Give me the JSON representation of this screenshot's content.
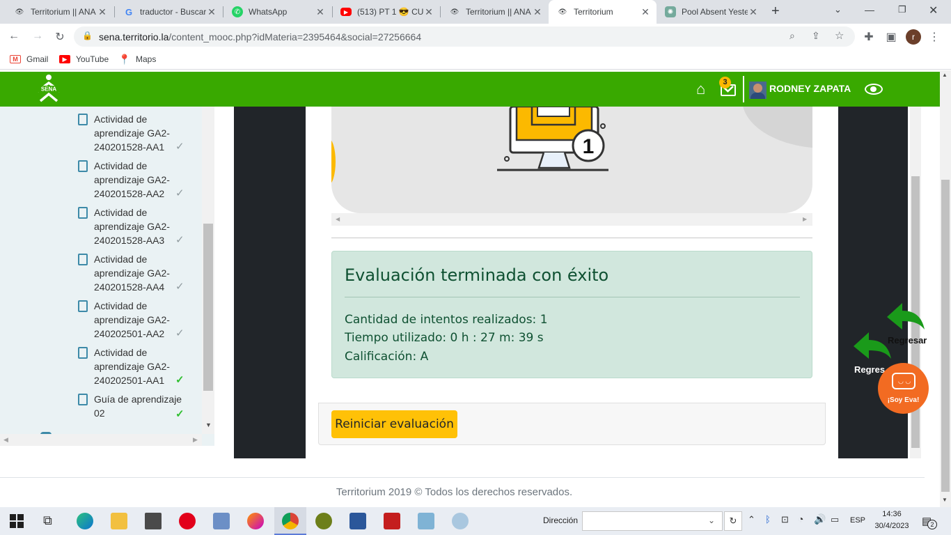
{
  "browser": {
    "tabs": [
      {
        "title": "Territorium || ANA",
        "icon": "eye-icon"
      },
      {
        "title": "traductor - Buscar",
        "icon": "google-icon"
      },
      {
        "title": "WhatsApp",
        "icon": "whatsapp-icon"
      },
      {
        "title": "(513) PT 1 😎 CU",
        "icon": "youtube-icon"
      },
      {
        "title": "Territorium || ANA",
        "icon": "eye-icon"
      },
      {
        "title": "Territorium",
        "icon": "eye-icon",
        "active": true
      },
      {
        "title": "Pool Absent Yester",
        "icon": "chatgpt-icon"
      }
    ],
    "url_domain": "sena.territorio.la",
    "url_path": "/content_mooc.php?idMateria=2395464&social=27256664",
    "profile_initial": "r",
    "bookmarks": [
      {
        "label": "Gmail",
        "icon": "gmail-icon"
      },
      {
        "label": "YouTube",
        "icon": "youtube-icon"
      },
      {
        "label": "Maps",
        "icon": "maps-icon"
      }
    ]
  },
  "header": {
    "logo_text": "SENA",
    "notifications_count": "3",
    "user_name": "RODNEY ZAPATA",
    "brand_color": "#39a900"
  },
  "sidebar": {
    "items": [
      {
        "label": "Actividad de aprendizaje GA2-240201528-AA1",
        "done": "grey"
      },
      {
        "label": "Actividad de aprendizaje GA2-240201528-AA2",
        "done": "grey"
      },
      {
        "label": "Actividad de aprendizaje GA2-240201528-AA3",
        "done": "grey"
      },
      {
        "label": "Actividad de aprendizaje GA2-240201528-AA4",
        "done": "grey"
      },
      {
        "label": "Actividad de aprendizaje GA2-240202501-AA2",
        "done": "grey"
      },
      {
        "label": "Actividad de aprendizaje GA2-240202501-AA1",
        "done": "green"
      },
      {
        "label": "Guía de aprendizaje 02",
        "done": "green"
      }
    ]
  },
  "illustration": {
    "badge_number": "1"
  },
  "result": {
    "title": "Evaluación terminada con éxito",
    "attempts": "Cantidad de intentos realizados: 1",
    "time": "Tiempo utilizado: 0 h : 27 m: 39 s",
    "grade": "Calificación: A"
  },
  "actions": {
    "restart_label": "Reiniciar evaluación"
  },
  "floating": {
    "back_label_1": "Regresar",
    "back_label_2": "Regres",
    "eva_label": "¡Soy Eva!"
  },
  "footer": {
    "text": "Territorium 2019 © Todos los derechos reservados."
  },
  "taskbar": {
    "address_label": "Dirección",
    "language": "ESP",
    "time": "14:36",
    "date": "30/4/2023",
    "notifications": "2"
  }
}
